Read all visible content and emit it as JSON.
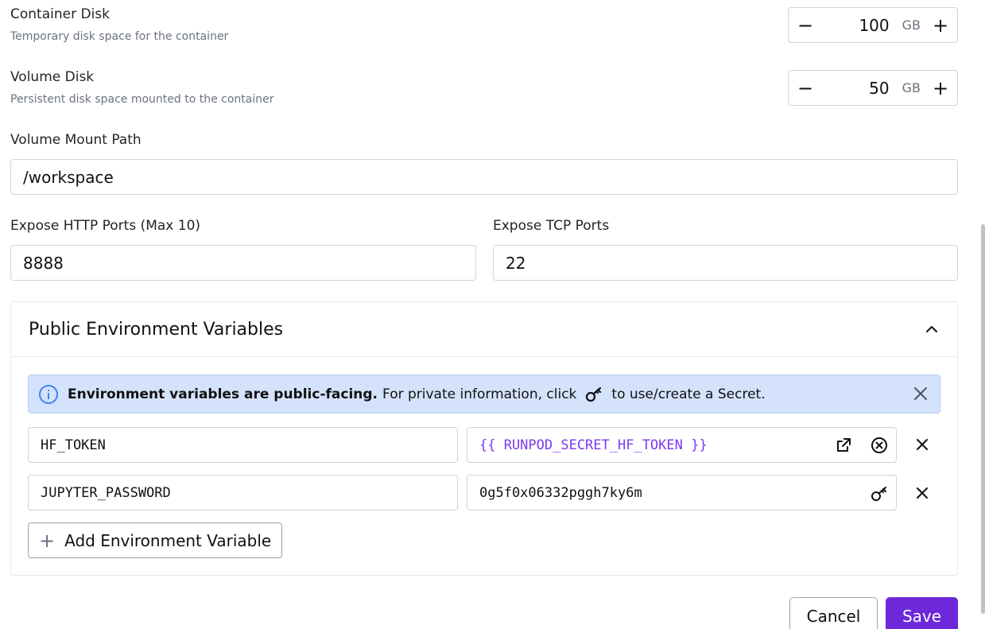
{
  "container_disk": {
    "label": "Container Disk",
    "description": "Temporary disk space for the container",
    "value": "100",
    "unit": "GB",
    "minus": "−",
    "plus": "+"
  },
  "volume_disk": {
    "label": "Volume Disk",
    "description": "Persistent disk space mounted to the container",
    "value": "50",
    "unit": "GB",
    "minus": "−",
    "plus": "+"
  },
  "volume_mount": {
    "label": "Volume Mount Path",
    "value": "/workspace"
  },
  "http_ports": {
    "label": "Expose HTTP Ports (Max 10)",
    "value": "8888"
  },
  "tcp_ports": {
    "label": "Expose TCP Ports",
    "value": "22"
  },
  "env_panel": {
    "title": "Public Environment Variables",
    "info_bold": "Environment variables are public-facing.",
    "info_text_1": "For private information, click",
    "info_text_2": "to use/create a Secret.",
    "rows": [
      {
        "key": "HF_TOKEN",
        "value": "{{ RUNPOD_SECRET_HF_TOKEN }}"
      },
      {
        "key": "JUPYTER_PASSWORD",
        "value": "0g5f0x06332pggh7ky6m"
      }
    ],
    "add_label": "Add Environment Variable",
    "add_plus": "+"
  },
  "actions": {
    "cancel": "Cancel",
    "save": "Save"
  },
  "colors": {
    "accent": "#6d28d9",
    "secret_text": "#7c3aed",
    "info_bg": "#d4e2fb"
  }
}
